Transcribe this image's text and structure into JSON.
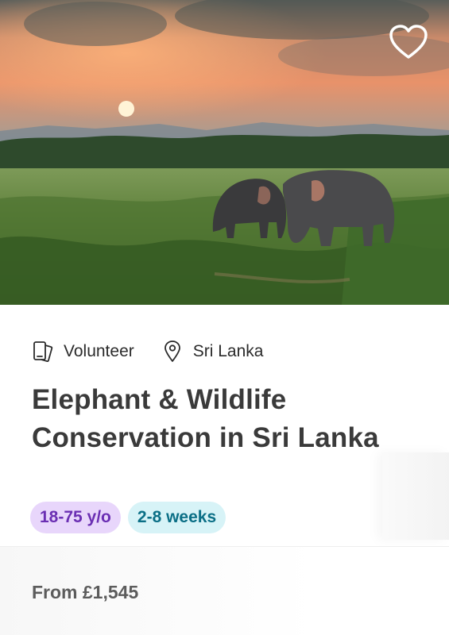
{
  "hero": {
    "image": "elephants-at-sunset-photo"
  },
  "favorite": {
    "icon": "heart-outline-icon"
  },
  "meta": {
    "category": {
      "icon": "phone-cards-icon",
      "label": "Volunteer"
    },
    "location": {
      "icon": "map-pin-icon",
      "label": "Sri Lanka"
    }
  },
  "title": "Elephant & Wildlife Conservation in Sri Lanka",
  "tags": {
    "age": "18-75 y/o",
    "duration": "2-8 weeks"
  },
  "price": "From £1,545",
  "colors": {
    "age_tag_bg": "#e8d6fb",
    "age_tag_text": "#6b2fb3",
    "duration_tag_bg": "#d7f3f7",
    "duration_tag_text": "#0b6f86"
  }
}
